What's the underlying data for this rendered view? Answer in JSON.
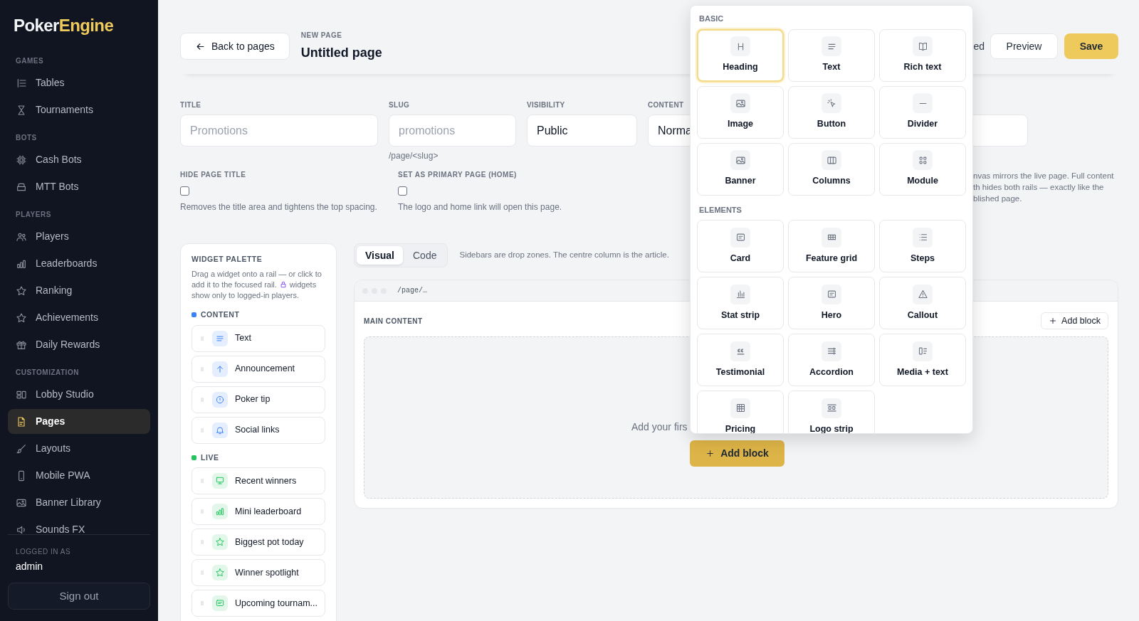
{
  "sidebar": {
    "logo": {
      "first": "Poker",
      "second": "Engine"
    },
    "sections": [
      {
        "title": "GAMES",
        "items": [
          {
            "label": "Tables",
            "selected": false
          },
          {
            "label": "Tournaments",
            "selected": false
          }
        ]
      },
      {
        "title": "BOTS",
        "items": [
          {
            "label": "Cash Bots",
            "selected": false
          },
          {
            "label": "MTT Bots",
            "selected": false
          }
        ]
      },
      {
        "title": "PLAYERS",
        "items": [
          {
            "label": "Players",
            "selected": false
          },
          {
            "label": "Leaderboards",
            "selected": false
          },
          {
            "label": "Ranking",
            "selected": false
          },
          {
            "label": "Achievements",
            "selected": false
          },
          {
            "label": "Daily Rewards",
            "selected": false
          }
        ]
      },
      {
        "title": "CUSTOMIZATION",
        "items": [
          {
            "label": "Lobby Studio",
            "selected": false
          },
          {
            "label": "Pages",
            "selected": true
          },
          {
            "label": "Layouts",
            "selected": false
          },
          {
            "label": "Mobile PWA",
            "selected": false
          },
          {
            "label": "Banner Library",
            "selected": false
          },
          {
            "label": "Sounds FX",
            "selected": false
          }
        ]
      }
    ],
    "footer": {
      "caption": "LOGGED IN AS",
      "user": "admin",
      "sign_out": "Sign out"
    }
  },
  "header": {
    "back": "Back to pages",
    "eyebrow": "NEW PAGE",
    "title": "Untitled page",
    "status": "ed",
    "preview": "Preview",
    "save": "Save"
  },
  "form": {
    "fields": [
      {
        "label": "TITLE",
        "placeholder": "Promotions"
      },
      {
        "label": "SLUG",
        "placeholder": "promotions",
        "hint": "/page/<slug>"
      },
      {
        "label": "VISIBILITY",
        "value": "Public"
      },
      {
        "label": "CONTENT",
        "value": "Norma"
      }
    ],
    "checks": [
      {
        "label": "HIDE PAGE TITLE",
        "checked": false,
        "description": "Removes the title area and tightens the top spacing."
      },
      {
        "label": "SET AS PRIMARY PAGE (HOME)",
        "checked": false,
        "description": "The logo and home link will open this page."
      }
    ],
    "note_lines": [
      "nvas mirrors the live page. Full content",
      "th hides both rails — exactly like the",
      "blished page."
    ]
  },
  "palette": {
    "title": "WIDGET PALETTE",
    "intro": {
      "line_1": "Drag a widget onto a rail — or click to",
      "line_2_before": "add it to the focused rail.",
      "line_2_after": "widgets",
      "line_3": "show only to logged-in players."
    },
    "groups": [
      {
        "title": "CONTENT",
        "color": "#3b82f6",
        "items": [
          "Text",
          "Announcement",
          "Poker tip",
          "Social links"
        ]
      },
      {
        "title": "LIVE",
        "color": "#22c55e",
        "items": [
          "Recent winners",
          "Mini leaderboard",
          "Biggest pot today",
          "Winner spotlight",
          "Upcoming tournam..."
        ]
      }
    ]
  },
  "editor": {
    "tabs": [
      {
        "label": "Visual",
        "selected": true
      },
      {
        "label": "Code",
        "selected": false
      }
    ],
    "tabs_note": "Sidebars are drop zones. The centre column is the article.",
    "url": "/page/…",
    "section_title": "MAIN CONTENT",
    "add_block_small": "Add block",
    "empty_text": "Add your firs",
    "add_block": "Add block"
  },
  "block_menu": {
    "sections": [
      {
        "title": "BASIC",
        "tiles": [
          {
            "label": "Heading",
            "selected": true
          },
          {
            "label": "Text",
            "selected": false
          },
          {
            "label": "Rich text",
            "selected": false
          },
          {
            "label": "Image",
            "selected": false
          },
          {
            "label": "Button",
            "selected": false
          },
          {
            "label": "Divider",
            "selected": false
          },
          {
            "label": "Banner",
            "selected": false
          },
          {
            "label": "Columns",
            "selected": false
          },
          {
            "label": "Module",
            "selected": false
          }
        ]
      },
      {
        "title": "ELEMENTS",
        "tiles": [
          {
            "label": "Card",
            "selected": false
          },
          {
            "label": "Feature grid",
            "selected": false
          },
          {
            "label": "Steps",
            "selected": false
          },
          {
            "label": "Stat strip",
            "selected": false
          },
          {
            "label": "Hero",
            "selected": false
          },
          {
            "label": "Callout",
            "selected": false
          },
          {
            "label": "Testimonial",
            "selected": false
          },
          {
            "label": "Accordion",
            "selected": false
          },
          {
            "label": "Media + text",
            "selected": false
          },
          {
            "label": "Pricing",
            "selected": false
          },
          {
            "label": "Logo strip",
            "selected": false
          }
        ]
      }
    ]
  }
}
